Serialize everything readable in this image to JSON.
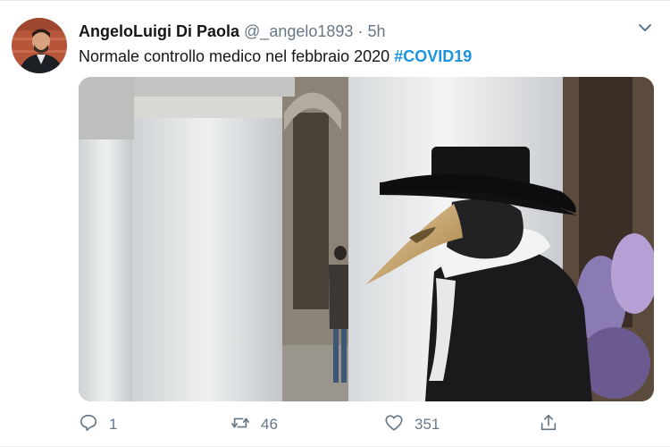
{
  "tweet": {
    "author_name": "AngeloLuigi Di Paola",
    "author_handle": "@_angelo1893",
    "separator": "·",
    "timestamp": "5h",
    "text": "Normale controllo medico nel febbraio 2020",
    "hashtag": "#COVID19",
    "media_description_icon": "photo",
    "accent_color": "#1b95e0"
  },
  "actions": {
    "reply_count": "1",
    "retweet_count": "46",
    "like_count": "351",
    "reply_icon": "reply-icon",
    "retweet_icon": "retweet-icon",
    "like_icon": "heart-icon",
    "share_icon": "share-icon"
  }
}
